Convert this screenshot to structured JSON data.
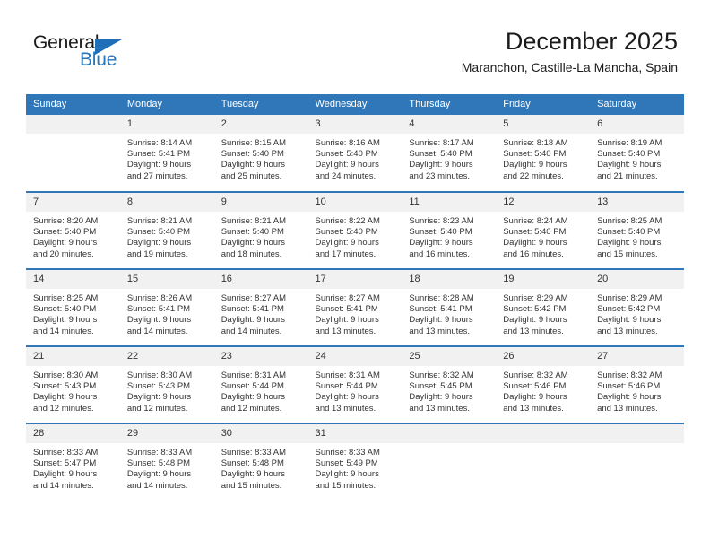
{
  "brand": {
    "name_top": "General",
    "name_bottom": "Blue",
    "accent_color": "#1f6fb8",
    "text_color": "#1b1b1b"
  },
  "header": {
    "title": "December 2025",
    "subtitle": "Maranchon, Castille-La Mancha, Spain"
  },
  "calendar": {
    "header_bg": "#2f77b8",
    "daynum_bg": "#f1f1f1",
    "weekdays": [
      "Sunday",
      "Monday",
      "Tuesday",
      "Wednesday",
      "Thursday",
      "Friday",
      "Saturday"
    ],
    "weeks": [
      [
        {
          "day": "",
          "blank": true,
          "sunrise": "",
          "sunset": "",
          "daylight_1": "",
          "daylight_2": ""
        },
        {
          "day": "1",
          "blank": false,
          "sunrise": "Sunrise: 8:14 AM",
          "sunset": "Sunset: 5:41 PM",
          "daylight_1": "Daylight: 9 hours",
          "daylight_2": "and 27 minutes."
        },
        {
          "day": "2",
          "blank": false,
          "sunrise": "Sunrise: 8:15 AM",
          "sunset": "Sunset: 5:40 PM",
          "daylight_1": "Daylight: 9 hours",
          "daylight_2": "and 25 minutes."
        },
        {
          "day": "3",
          "blank": false,
          "sunrise": "Sunrise: 8:16 AM",
          "sunset": "Sunset: 5:40 PM",
          "daylight_1": "Daylight: 9 hours",
          "daylight_2": "and 24 minutes."
        },
        {
          "day": "4",
          "blank": false,
          "sunrise": "Sunrise: 8:17 AM",
          "sunset": "Sunset: 5:40 PM",
          "daylight_1": "Daylight: 9 hours",
          "daylight_2": "and 23 minutes."
        },
        {
          "day": "5",
          "blank": false,
          "sunrise": "Sunrise: 8:18 AM",
          "sunset": "Sunset: 5:40 PM",
          "daylight_1": "Daylight: 9 hours",
          "daylight_2": "and 22 minutes."
        },
        {
          "day": "6",
          "blank": false,
          "sunrise": "Sunrise: 8:19 AM",
          "sunset": "Sunset: 5:40 PM",
          "daylight_1": "Daylight: 9 hours",
          "daylight_2": "and 21 minutes."
        }
      ],
      [
        {
          "day": "7",
          "blank": false,
          "sunrise": "Sunrise: 8:20 AM",
          "sunset": "Sunset: 5:40 PM",
          "daylight_1": "Daylight: 9 hours",
          "daylight_2": "and 20 minutes."
        },
        {
          "day": "8",
          "blank": false,
          "sunrise": "Sunrise: 8:21 AM",
          "sunset": "Sunset: 5:40 PM",
          "daylight_1": "Daylight: 9 hours",
          "daylight_2": "and 19 minutes."
        },
        {
          "day": "9",
          "blank": false,
          "sunrise": "Sunrise: 8:21 AM",
          "sunset": "Sunset: 5:40 PM",
          "daylight_1": "Daylight: 9 hours",
          "daylight_2": "and 18 minutes."
        },
        {
          "day": "10",
          "blank": false,
          "sunrise": "Sunrise: 8:22 AM",
          "sunset": "Sunset: 5:40 PM",
          "daylight_1": "Daylight: 9 hours",
          "daylight_2": "and 17 minutes."
        },
        {
          "day": "11",
          "blank": false,
          "sunrise": "Sunrise: 8:23 AM",
          "sunset": "Sunset: 5:40 PM",
          "daylight_1": "Daylight: 9 hours",
          "daylight_2": "and 16 minutes."
        },
        {
          "day": "12",
          "blank": false,
          "sunrise": "Sunrise: 8:24 AM",
          "sunset": "Sunset: 5:40 PM",
          "daylight_1": "Daylight: 9 hours",
          "daylight_2": "and 16 minutes."
        },
        {
          "day": "13",
          "blank": false,
          "sunrise": "Sunrise: 8:25 AM",
          "sunset": "Sunset: 5:40 PM",
          "daylight_1": "Daylight: 9 hours",
          "daylight_2": "and 15 minutes."
        }
      ],
      [
        {
          "day": "14",
          "blank": false,
          "sunrise": "Sunrise: 8:25 AM",
          "sunset": "Sunset: 5:40 PM",
          "daylight_1": "Daylight: 9 hours",
          "daylight_2": "and 14 minutes."
        },
        {
          "day": "15",
          "blank": false,
          "sunrise": "Sunrise: 8:26 AM",
          "sunset": "Sunset: 5:41 PM",
          "daylight_1": "Daylight: 9 hours",
          "daylight_2": "and 14 minutes."
        },
        {
          "day": "16",
          "blank": false,
          "sunrise": "Sunrise: 8:27 AM",
          "sunset": "Sunset: 5:41 PM",
          "daylight_1": "Daylight: 9 hours",
          "daylight_2": "and 14 minutes."
        },
        {
          "day": "17",
          "blank": false,
          "sunrise": "Sunrise: 8:27 AM",
          "sunset": "Sunset: 5:41 PM",
          "daylight_1": "Daylight: 9 hours",
          "daylight_2": "and 13 minutes."
        },
        {
          "day": "18",
          "blank": false,
          "sunrise": "Sunrise: 8:28 AM",
          "sunset": "Sunset: 5:41 PM",
          "daylight_1": "Daylight: 9 hours",
          "daylight_2": "and 13 minutes."
        },
        {
          "day": "19",
          "blank": false,
          "sunrise": "Sunrise: 8:29 AM",
          "sunset": "Sunset: 5:42 PM",
          "daylight_1": "Daylight: 9 hours",
          "daylight_2": "and 13 minutes."
        },
        {
          "day": "20",
          "blank": false,
          "sunrise": "Sunrise: 8:29 AM",
          "sunset": "Sunset: 5:42 PM",
          "daylight_1": "Daylight: 9 hours",
          "daylight_2": "and 13 minutes."
        }
      ],
      [
        {
          "day": "21",
          "blank": false,
          "sunrise": "Sunrise: 8:30 AM",
          "sunset": "Sunset: 5:43 PM",
          "daylight_1": "Daylight: 9 hours",
          "daylight_2": "and 12 minutes."
        },
        {
          "day": "22",
          "blank": false,
          "sunrise": "Sunrise: 8:30 AM",
          "sunset": "Sunset: 5:43 PM",
          "daylight_1": "Daylight: 9 hours",
          "daylight_2": "and 12 minutes."
        },
        {
          "day": "23",
          "blank": false,
          "sunrise": "Sunrise: 8:31 AM",
          "sunset": "Sunset: 5:44 PM",
          "daylight_1": "Daylight: 9 hours",
          "daylight_2": "and 12 minutes."
        },
        {
          "day": "24",
          "blank": false,
          "sunrise": "Sunrise: 8:31 AM",
          "sunset": "Sunset: 5:44 PM",
          "daylight_1": "Daylight: 9 hours",
          "daylight_2": "and 13 minutes."
        },
        {
          "day": "25",
          "blank": false,
          "sunrise": "Sunrise: 8:32 AM",
          "sunset": "Sunset: 5:45 PM",
          "daylight_1": "Daylight: 9 hours",
          "daylight_2": "and 13 minutes."
        },
        {
          "day": "26",
          "blank": false,
          "sunrise": "Sunrise: 8:32 AM",
          "sunset": "Sunset: 5:46 PM",
          "daylight_1": "Daylight: 9 hours",
          "daylight_2": "and 13 minutes."
        },
        {
          "day": "27",
          "blank": false,
          "sunrise": "Sunrise: 8:32 AM",
          "sunset": "Sunset: 5:46 PM",
          "daylight_1": "Daylight: 9 hours",
          "daylight_2": "and 13 minutes."
        }
      ],
      [
        {
          "day": "28",
          "blank": false,
          "sunrise": "Sunrise: 8:33 AM",
          "sunset": "Sunset: 5:47 PM",
          "daylight_1": "Daylight: 9 hours",
          "daylight_2": "and 14 minutes."
        },
        {
          "day": "29",
          "blank": false,
          "sunrise": "Sunrise: 8:33 AM",
          "sunset": "Sunset: 5:48 PM",
          "daylight_1": "Daylight: 9 hours",
          "daylight_2": "and 14 minutes."
        },
        {
          "day": "30",
          "blank": false,
          "sunrise": "Sunrise: 8:33 AM",
          "sunset": "Sunset: 5:48 PM",
          "daylight_1": "Daylight: 9 hours",
          "daylight_2": "and 15 minutes."
        },
        {
          "day": "31",
          "blank": false,
          "sunrise": "Sunrise: 8:33 AM",
          "sunset": "Sunset: 5:49 PM",
          "daylight_1": "Daylight: 9 hours",
          "daylight_2": "and 15 minutes."
        },
        {
          "day": "",
          "blank": true,
          "sunrise": "",
          "sunset": "",
          "daylight_1": "",
          "daylight_2": ""
        },
        {
          "day": "",
          "blank": true,
          "sunrise": "",
          "sunset": "",
          "daylight_1": "",
          "daylight_2": ""
        },
        {
          "day": "",
          "blank": true,
          "sunrise": "",
          "sunset": "",
          "daylight_1": "",
          "daylight_2": ""
        }
      ]
    ]
  }
}
